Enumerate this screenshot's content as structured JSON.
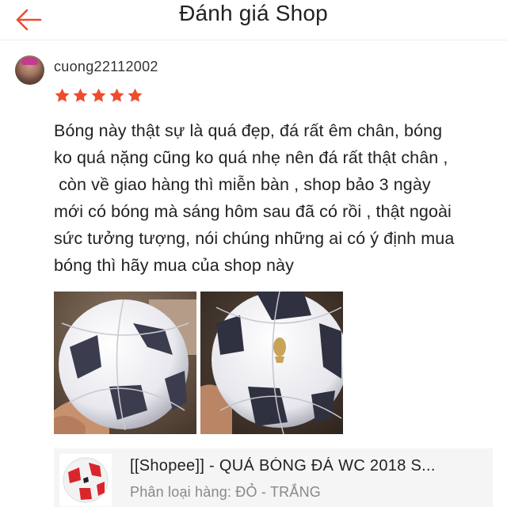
{
  "header": {
    "title": "Đánh giá Shop",
    "back_icon": "arrow-left-icon",
    "accent_color": "#ee4d2d"
  },
  "review": {
    "username": "cuong22112002",
    "rating": 5,
    "rating_max": 5,
    "star_color": "#ee4d2d",
    "text": "Bóng này thật sự là quá đẹp, đá rất êm chân, bóng ko quá nặng cũng ko quá nhẹ nên đá rất thật chân , còn về giao hàng thì miễn bàn , shop bảo 3 ngày mới có bóng mà sáng hôm sau đã có rồi , thật ngoài sức tưởng tượng, nói chúng những ai có ý định mua bóng thì hãy mua của shop này",
    "text_lines": [
      "Bóng này thật sự là quá đẹp, đá rất êm chân, bóng",
      "ko quá nặng cũng ko quá nhẹ nên đá rất thật chân ,",
      " còn về giao hàng thì miễn bàn , shop bảo 3 ngày",
      "mới có bóng mà sáng hôm sau đã có rồi , thật ngoài",
      "sức tưởng tượng, nói chúng những ai có ý định mua",
      "bóng thì hãy mua của shop này"
    ],
    "photos": [
      "soccer-ball-photo",
      "soccer-ball-photo"
    ]
  },
  "product": {
    "name": "[[Shopee]] - QUẢ BÓNG ĐÁ WC 2018 S...",
    "variant": "Phân loại hàng: ĐỎ - TRẮNG",
    "thumb_icon": "red-soccer-ball-thumbnail"
  }
}
